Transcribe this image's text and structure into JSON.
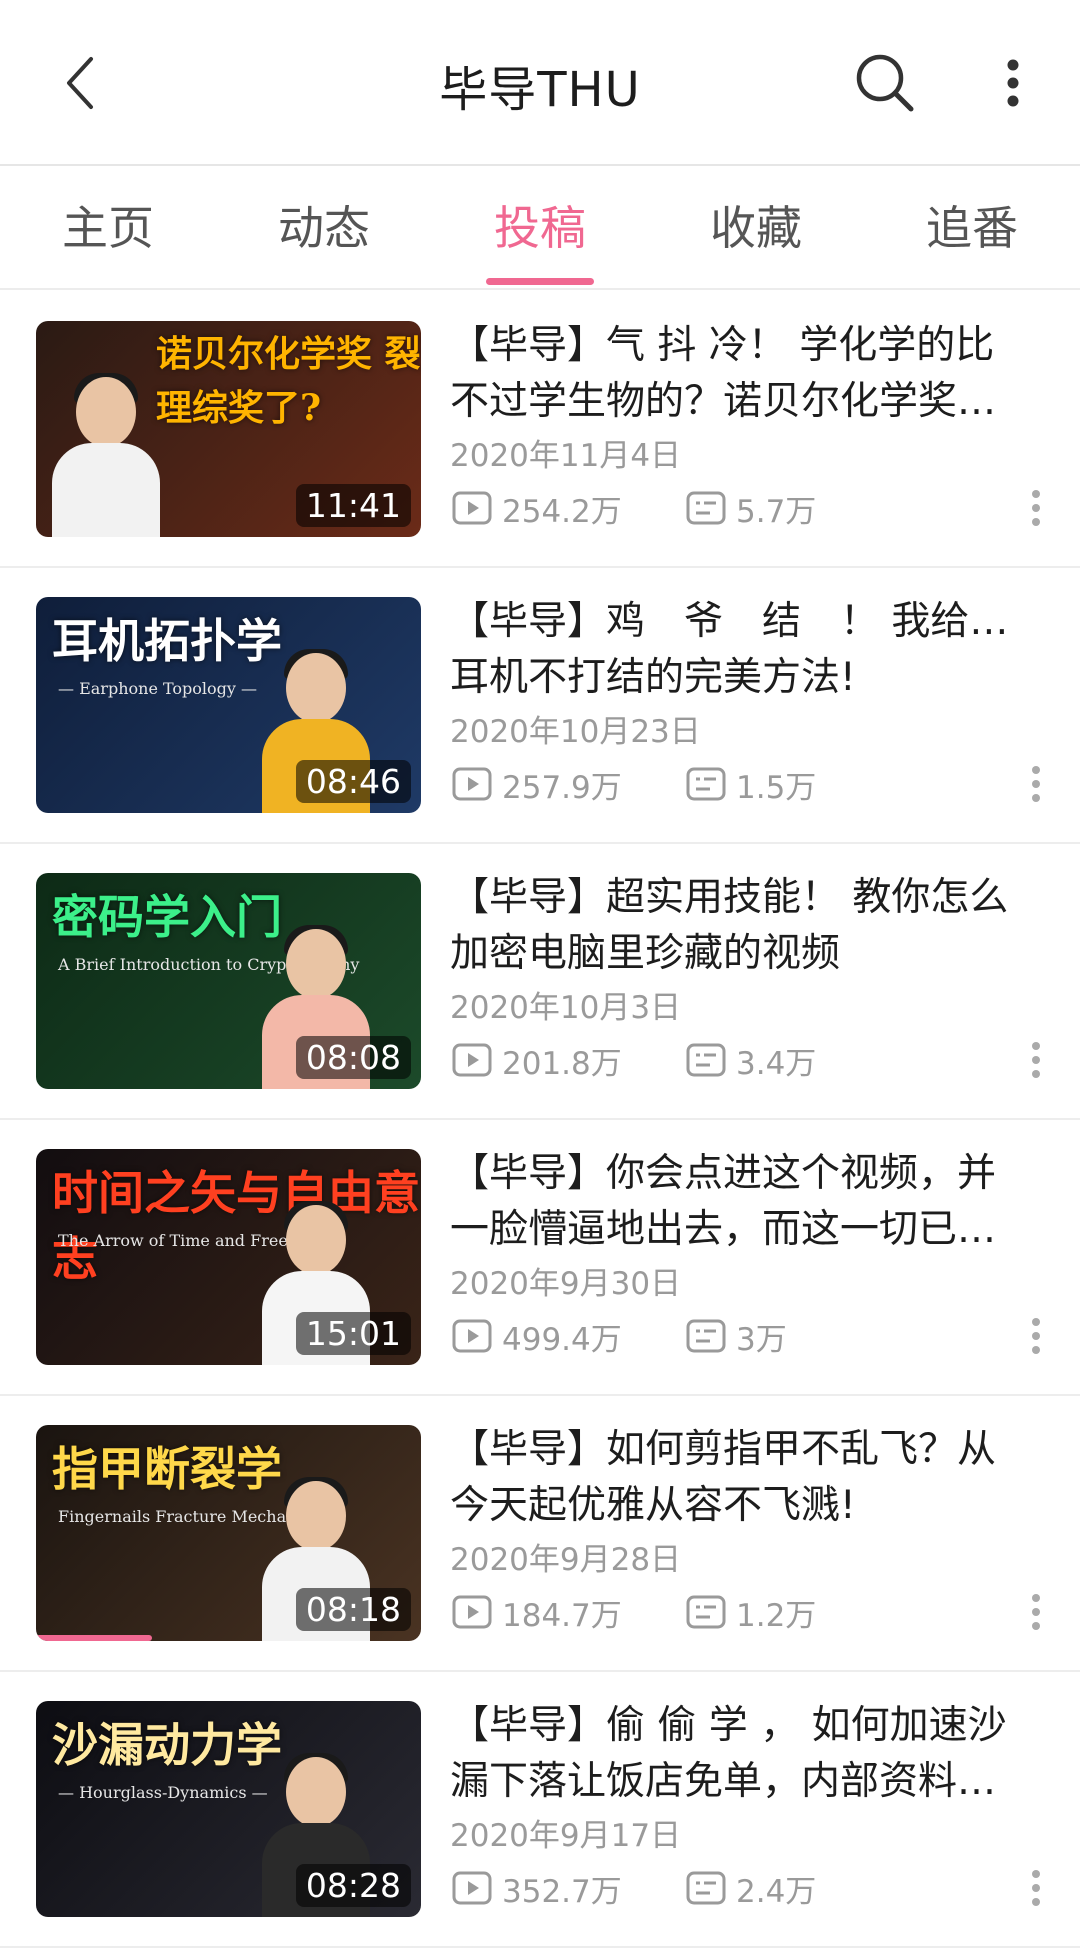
{
  "header": {
    "title": "毕导THU",
    "back_icon": "back-arrow-icon",
    "search_icon": "search-icon",
    "more_icon": "more-vertical-icon"
  },
  "tabs": [
    {
      "label": "主页"
    },
    {
      "label": "动态"
    },
    {
      "label": "投稿",
      "active": true
    },
    {
      "label": "收藏"
    },
    {
      "label": "追番"
    }
  ],
  "accent_color": "#f06891",
  "videos": [
    {
      "title_line1": "【毕导】气 抖 冷！ 学化学的比",
      "title_line2": "不过学生物的？诺贝尔化学奖…",
      "date": "2020年11月4日",
      "plays": "254.2万",
      "danmaku": "5.7万",
      "duration": "11:41",
      "thumb_text": "诺贝尔化学奖 裂变理综奖了?",
      "thumb_colors": [
        "#2a1a14",
        "#6b2b18"
      ]
    },
    {
      "title_line1": "【毕导】鸡　爷　结　！ 我给出了",
      "title_line2": "耳机不打结的完美方法!",
      "date": "2020年10月23日",
      "plays": "257.9万",
      "danmaku": "1.5万",
      "duration": "08:46",
      "thumb_text": "耳机拓扑学",
      "thumb_sub": "— Earphone Topology —",
      "thumb_colors": [
        "#0f1e3a",
        "#1f3a66"
      ]
    },
    {
      "title_line1": "【毕导】超实用技能！ 教你怎么",
      "title_line2": "加密电脑里珍藏的视频",
      "date": "2020年10月3日",
      "plays": "201.8万",
      "danmaku": "3.4万",
      "duration": "08:08",
      "thumb_text": "密码学入门",
      "thumb_sub": "A Brief Introduction to Cryptography",
      "thumb_colors": [
        "#0d2a16",
        "#1c4a2a"
      ]
    },
    {
      "title_line1": "【毕导】你会点进这个视频，并",
      "title_line2": "一脸懵逼地出去，而这一切已…",
      "date": "2020年9月30日",
      "plays": "499.4万",
      "danmaku": "3万",
      "duration": "15:01",
      "thumb_text": "时间之矢与自由意志",
      "thumb_sub": "The Arrow of Time and Free Will",
      "thumb_colors": [
        "#120d10",
        "#3a2418"
      ]
    },
    {
      "title_line1": "【毕导】如何剪指甲不乱飞？从",
      "title_line2": "今天起优雅从容不飞溅!",
      "date": "2020年9月28日",
      "plays": "184.7万",
      "danmaku": "1.2万",
      "duration": "08:18",
      "progress": 0.3,
      "thumb_text": "指甲断裂学",
      "thumb_sub": "Fingernails Fracture Mechanics",
      "thumb_colors": [
        "#1a1410",
        "#4a3322"
      ]
    },
    {
      "title_line1": "【毕导】偷 偷 学 ， 如何加速沙",
      "title_line2": "漏下落让饭店免单，内部资料…",
      "date": "2020年9月17日",
      "plays": "352.7万",
      "danmaku": "2.4万",
      "duration": "08:28",
      "thumb_text": "沙漏动力学",
      "thumb_sub": "— Hourglass-Dynamics —",
      "thumb_colors": [
        "#0d0d12",
        "#2a2a33"
      ]
    }
  ]
}
